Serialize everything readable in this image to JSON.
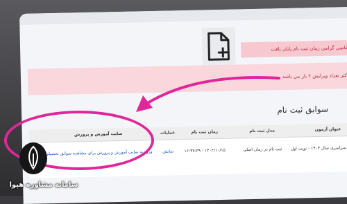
{
  "alert": {
    "top_message": "متقاضی گرامی زمان ثبت نام پایان یافت",
    "edit_limit": "حداکثر تعداد ویرایش ۲ بار می باشد"
  },
  "section": {
    "title": "سوابق ثبت نام"
  },
  "table": {
    "headers": [
      "عنوان آزمون",
      "مدل ثبت نام",
      "زمان ثبت نام",
      "عملیات",
      "سایت آموزش و پرورش"
    ],
    "row": [
      "آزمون سراسری سال ۱۴۰۳ - نوبت اول",
      "ثبت نام در زمان اصلی",
      "۱۴۰۲/۱۰/۱۵ - ۱۶:۴۷:۳۹",
      "نمایش",
      "ورود به سایت آموزش و پرورش برای مشاهده سوابق تحصیلی"
    ]
  },
  "watermark": {
    "brand": "سامانه مشاوره هپوا"
  },
  "colors": {
    "highlight": "#e0279a",
    "alert_text": "#b2283f",
    "alert_bg": "#f7c8d0"
  }
}
